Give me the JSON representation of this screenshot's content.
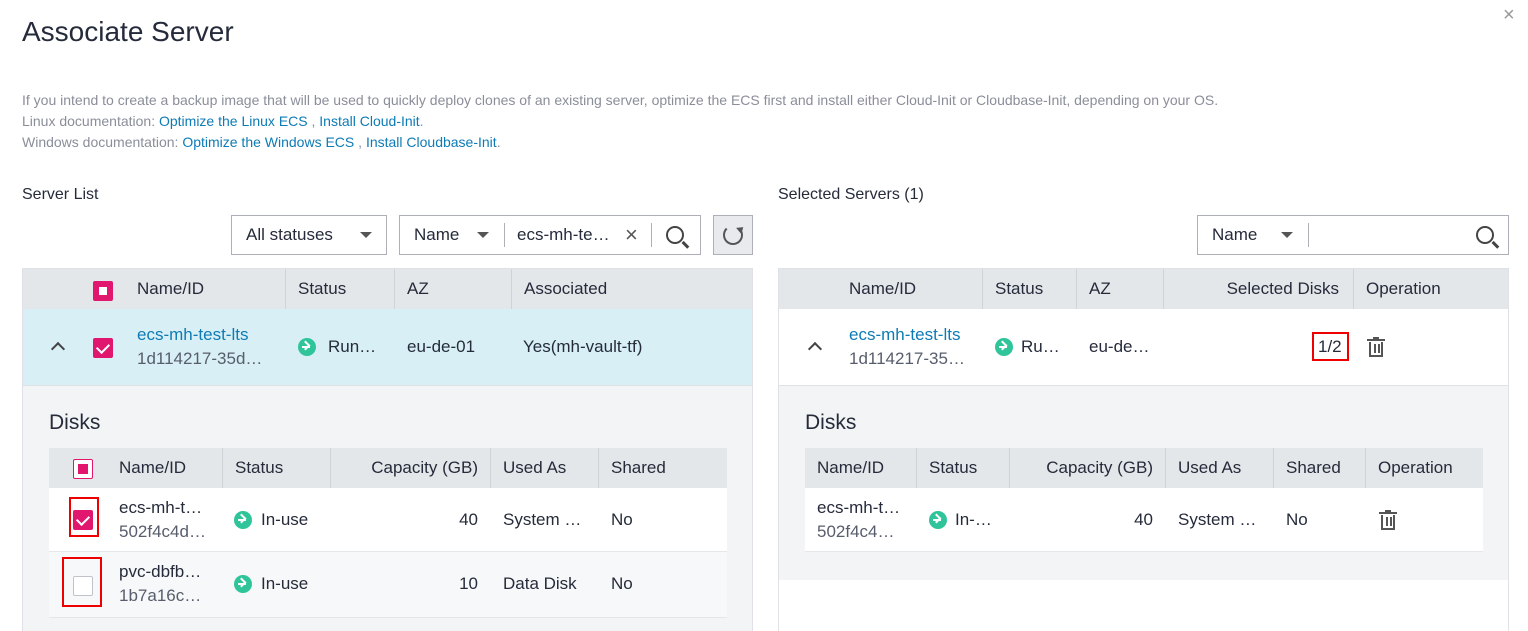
{
  "dialog": {
    "title": "Associate Server",
    "close_icon": "×"
  },
  "info": {
    "line1": "If you intend to create a backup image that will be used to quickly deploy clones of an existing server, optimize the ECS first and install either Cloud-Init or Cloudbase-Init, depending on your OS.",
    "linux_prefix": "Linux documentation: ",
    "linux_link1": "Optimize the Linux ECS",
    "linux_sep": " , ",
    "linux_link2": "Install Cloud-Init",
    "linux_suffix": ".",
    "windows_prefix": "Windows documentation: ",
    "windows_link1": "Optimize the Windows ECS",
    "windows_sep": " , ",
    "windows_link2": "Install Cloudbase-Init",
    "windows_suffix": "."
  },
  "server_list": {
    "label": "Server List",
    "status_filter": "All statuses",
    "search_field": "Name",
    "search_value": "ecs-mh-te…",
    "clear_icon": "×",
    "columns": [
      "Name/ID",
      "Status",
      "AZ",
      "Associated"
    ],
    "row": {
      "name": "ecs-mh-test-lts",
      "id": "1d114217-35d…",
      "status": "Run…",
      "az": "eu-de-01",
      "associated": "Yes(mh-vault-tf)"
    },
    "disks": {
      "label": "Disks",
      "columns": [
        "Name/ID",
        "Status",
        "Capacity (GB)",
        "Used As",
        "Shared"
      ],
      "rows": [
        {
          "name": "ecs-mh-t…",
          "id": "502f4c4d…",
          "status": "In-use",
          "capacity": "40",
          "used_as": "System …",
          "shared": "No"
        },
        {
          "name": "pvc-dbfb…",
          "id": "1b7a16c…",
          "status": "In-use",
          "capacity": "10",
          "used_as": "Data Disk",
          "shared": "No"
        }
      ]
    }
  },
  "selected_servers": {
    "label": "Selected Servers (1)",
    "search_field": "Name",
    "columns": [
      "Name/ID",
      "Status",
      "AZ",
      "Selected Disks",
      "Operation"
    ],
    "row": {
      "name": "ecs-mh-test-lts",
      "id": "1d114217-35…",
      "status": "Ru…",
      "az": "eu-de…",
      "selected_disks": "1/2"
    },
    "disks": {
      "label": "Disks",
      "columns": [
        "Name/ID",
        "Status",
        "Capacity (GB)",
        "Used As",
        "Shared",
        "Operation"
      ],
      "rows": [
        {
          "name": "ecs-mh-t…",
          "id": "502f4c4…",
          "status": "In-…",
          "capacity": "40",
          "used_as": "System …",
          "shared": "No"
        }
      ]
    }
  },
  "colors": {
    "accent": "#e0166f",
    "link": "#0e7bb5",
    "running": "#2fc49a",
    "highlight_row": "#d8f0f5",
    "header_bg": "#e4e7ea"
  }
}
